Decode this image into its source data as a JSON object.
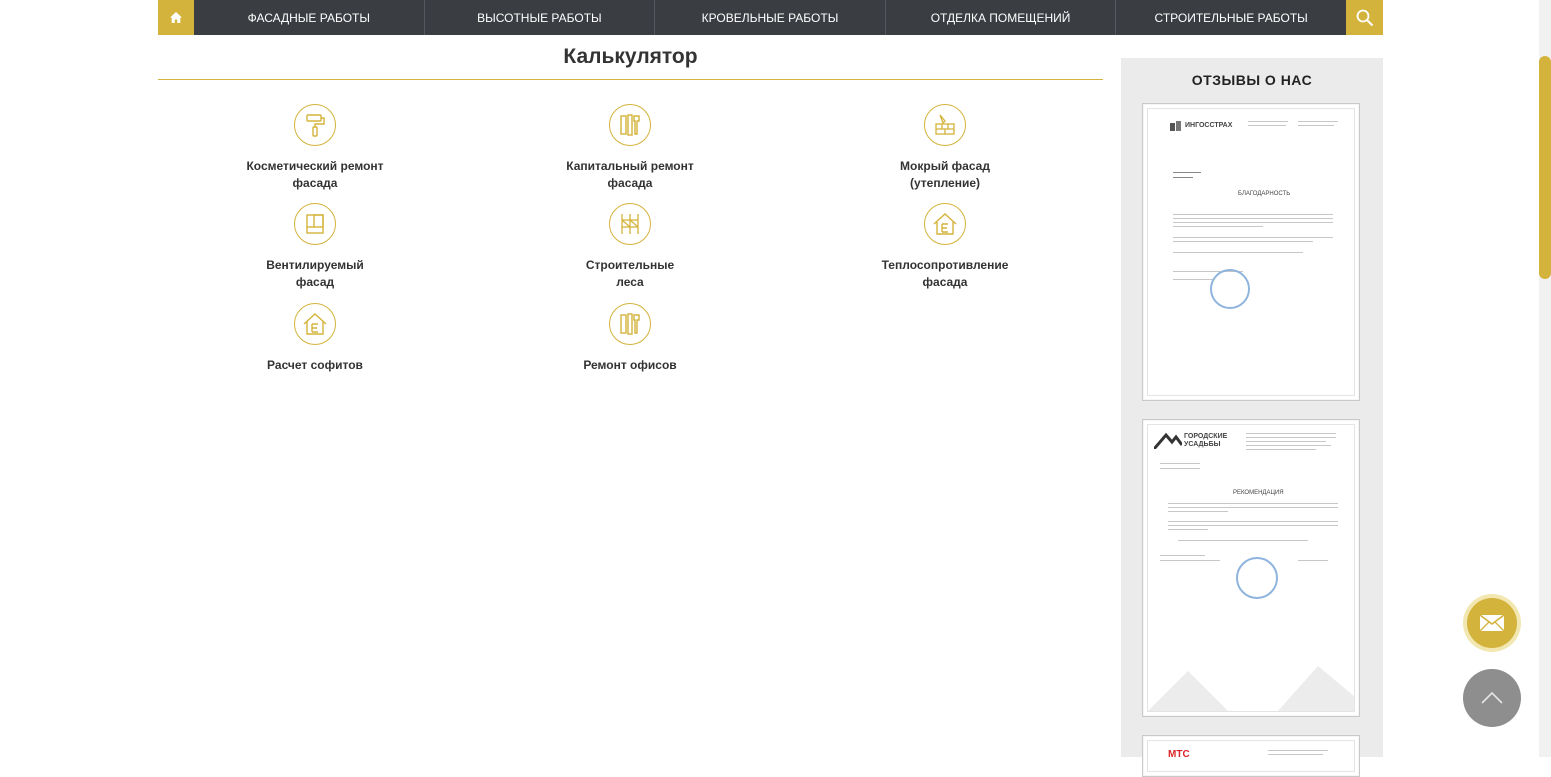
{
  "nav": {
    "items": [
      "ФАСАДНЫЕ РАБОТЫ",
      "ВЫСОТНЫЕ РАБОТЫ",
      "КРОВЕЛЬНЫЕ РАБОТЫ",
      "ОТДЕЛКА ПОМЕЩЕНИЙ",
      "СТРОИТЕЛЬНЫЕ РАБОТЫ"
    ]
  },
  "calculator": {
    "title": "Калькулятор",
    "items": [
      {
        "label": "Косметический ремонт\nфасада",
        "icon": "paint-roller-icon"
      },
      {
        "label": "Капитальный ремонт\nфасада",
        "icon": "tools-icon"
      },
      {
        "label": "Мокрый фасад\n(утепление)",
        "icon": "bricks-trowel-icon"
      },
      {
        "label": "Вентилируемый\nфасад",
        "icon": "facade-panel-icon"
      },
      {
        "label": "Строительные\nлеса",
        "icon": "scaffolding-icon"
      },
      {
        "label": "Теплосопротивление\nфасада",
        "icon": "house-icon"
      },
      {
        "label": "Расчет софитов",
        "icon": "house-icon"
      },
      {
        "label": "Ремонт офисов",
        "icon": "tools-icon"
      }
    ]
  },
  "sidebar": {
    "title": "ОТЗЫВЫ О НАС",
    "docs": [
      {
        "logo": "ИНГОССТРАХ",
        "heading": "БЛАГОДАРНОСТЬ"
      },
      {
        "logo": "ГОРОДСКИЕ УСАДЬБЫ",
        "heading": "РЕКОМЕНДАЦИЯ"
      },
      {
        "logo": "МТС",
        "heading": ""
      }
    ]
  },
  "colors": {
    "accent": "#d4b33c",
    "nav_bg": "#3a3d42",
    "sidebar_bg": "#ebebeb"
  }
}
